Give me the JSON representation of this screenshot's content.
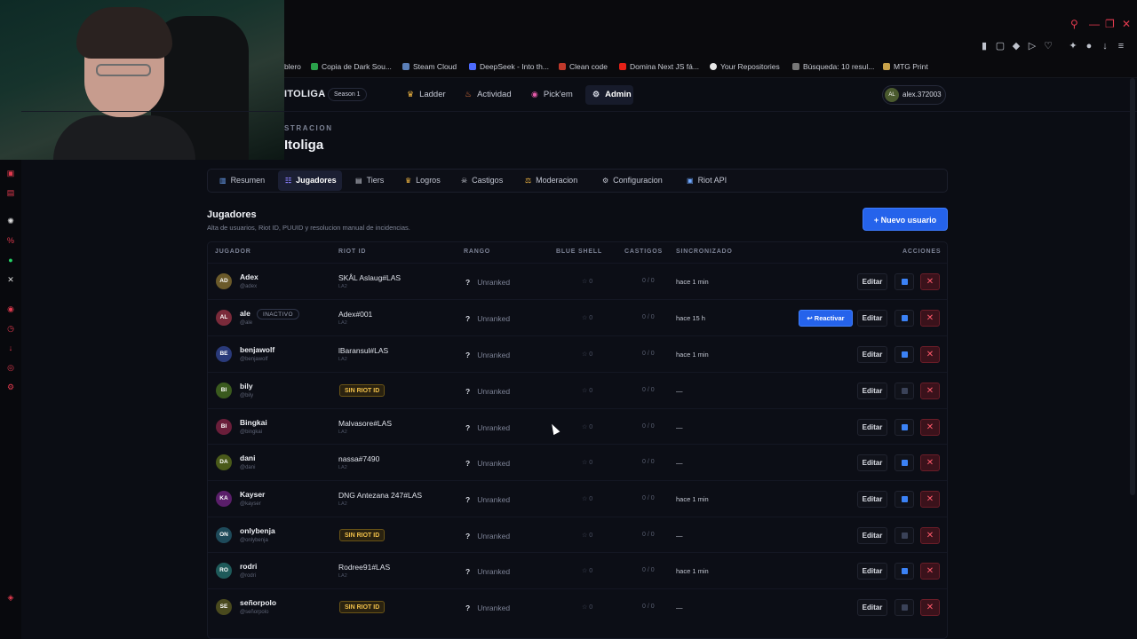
{
  "bookmarks": [
    "blero",
    "Copia de Dark Sou...",
    "Steam Cloud",
    "DeepSeek - Into th...",
    "Clean code",
    "Domina Next JS fá...",
    "Your Repositories",
    "Búsqueda: 10 resul...",
    "MTG Print"
  ],
  "nav": {
    "brand": "ITOLIGA",
    "season": "Season 1",
    "items": [
      "Ladder",
      "Actividad",
      "Pick'em",
      "Admin"
    ],
    "user_initials": "AL",
    "user": "alex.372003"
  },
  "page": {
    "eyebrow": "STRACION",
    "title": "Itoliga"
  },
  "tabs": [
    "Resumen",
    "Jugadores",
    "Tiers",
    "Logros",
    "Castigos",
    "Moderacion",
    "Configuracion",
    "Riot API"
  ],
  "section": {
    "title": "Jugadores",
    "subtitle": "Alta de usuarios, Riot ID, PUUID y resolucion manual de incidencias.",
    "new_button": "+ Nuevo usuario"
  },
  "table": {
    "headers": [
      "JUGADOR",
      "RIOT ID",
      "RANGO",
      "BLUE SHELL",
      "CASTIGOS",
      "SINCRONIZADO",
      "ACCIONES"
    ],
    "edit_label": "Editar",
    "reactivate_label": "↩ Reactivar",
    "inactive_label": "INACTIVO",
    "no_riot_label": "SIN RIOT ID",
    "rank_mark": "?",
    "rows": [
      {
        "initials": "AD",
        "name": "Adex",
        "handle": "@adex",
        "riot": "SKÅL Aslaug#LAS",
        "region": "LA2",
        "rank": "Unranked",
        "blue": "0",
        "cast": "0 / 0",
        "sync": "hace 1 min",
        "color": "#6b5a2a",
        "sync_color": "#3b82f6"
      },
      {
        "initials": "AL",
        "name": "ale",
        "handle": "@ale",
        "riot": "Adex#001",
        "region": "LA2",
        "rank": "Unranked",
        "blue": "0",
        "cast": "0 / 0",
        "sync": "hace 15 h",
        "color": "#7a2a3a",
        "inactive": true,
        "reactivate": true,
        "sync_color": "#3b82f6"
      },
      {
        "initials": "BE",
        "name": "benjawolf",
        "handle": "@benjawolf",
        "riot": "lBaransul#LAS",
        "region": "LA2",
        "rank": "Unranked",
        "blue": "0",
        "cast": "0 / 0",
        "sync": "hace 1 min",
        "color": "#2a3a7a",
        "sync_color": "#3b82f6"
      },
      {
        "initials": "BI",
        "name": "bily",
        "handle": "@bily",
        "riot": "",
        "region": "",
        "rank": "Unranked",
        "blue": "0",
        "cast": "0 / 0",
        "sync": "—",
        "color": "#3a5a1e",
        "no_riot": true,
        "sync_color": "#3a4258"
      },
      {
        "initials": "BI",
        "name": "Bingkai",
        "handle": "@bingkai",
        "riot": "Malvasore#LAS",
        "region": "LA2",
        "rank": "Unranked",
        "blue": "0",
        "cast": "0 / 0",
        "sync": "—",
        "color": "#6a1e3a",
        "sync_color": "#3b82f6"
      },
      {
        "initials": "DA",
        "name": "dani",
        "handle": "@dani",
        "riot": "nassa#7490",
        "region": "LA2",
        "rank": "Unranked",
        "blue": "0",
        "cast": "0 / 0",
        "sync": "—",
        "color": "#4a5a1a",
        "sync_color": "#3b82f6"
      },
      {
        "initials": "KA",
        "name": "Kayser",
        "handle": "@kayser",
        "riot": "DNG Antezana 247#LAS",
        "region": "LA2",
        "rank": "Unranked",
        "blue": "0",
        "cast": "0 / 0",
        "sync": "hace 1 min",
        "color": "#5a1e6a",
        "sync_color": "#3b82f6"
      },
      {
        "initials": "ON",
        "name": "onlybenja",
        "handle": "@onlybenja",
        "riot": "",
        "region": "",
        "rank": "Unranked",
        "blue": "0",
        "cast": "0 / 0",
        "sync": "—",
        "color": "#1e4a5a",
        "no_riot": true,
        "sync_color": "#3a4258"
      },
      {
        "initials": "RO",
        "name": "rodri",
        "handle": "@rodri",
        "riot": "Rodree91#LAS",
        "region": "LA2",
        "rank": "Unranked",
        "blue": "0",
        "cast": "0 / 0",
        "sync": "hace 1 min",
        "color": "#1e5a5a",
        "sync_color": "#3b82f6"
      },
      {
        "initials": "SE",
        "name": "señorpolo",
        "handle": "@señorpolo",
        "riot": "",
        "region": "",
        "rank": "Unranked",
        "blue": "0",
        "cast": "0 / 0",
        "sync": "—",
        "color": "#4a4a1e",
        "no_riot": true,
        "sync_color": "#3a4258"
      }
    ]
  }
}
